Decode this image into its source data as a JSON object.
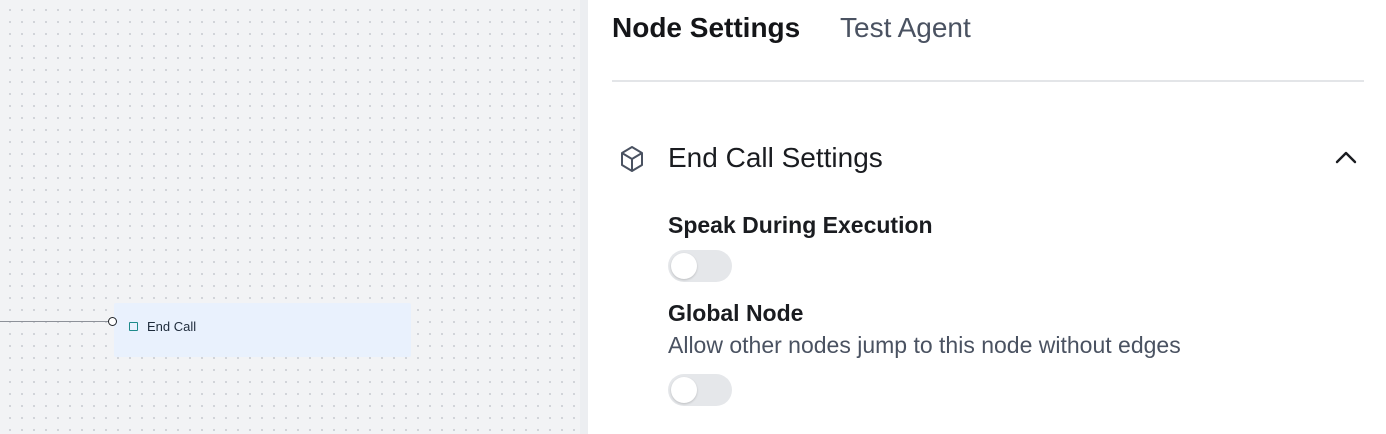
{
  "canvas": {
    "end_node": {
      "label": "End Call",
      "icon": "square-icon",
      "background_color": "#e9f1fd"
    }
  },
  "panel": {
    "tabs": [
      {
        "label": "Node Settings",
        "active": true
      },
      {
        "label": "Test Agent",
        "active": false
      }
    ],
    "section": {
      "title": "End Call Settings",
      "icon": "cube-icon",
      "expanded": true
    },
    "settings": [
      {
        "label": "Speak During Execution",
        "description": "",
        "enabled": false
      },
      {
        "label": "Global Node",
        "description": "Allow other nodes jump to this node without edges",
        "enabled": false
      }
    ]
  },
  "colors": {
    "toggle_off": "#e5e7ea",
    "primary_text": "#1a1c20",
    "secondary_text": "#4a5261"
  }
}
